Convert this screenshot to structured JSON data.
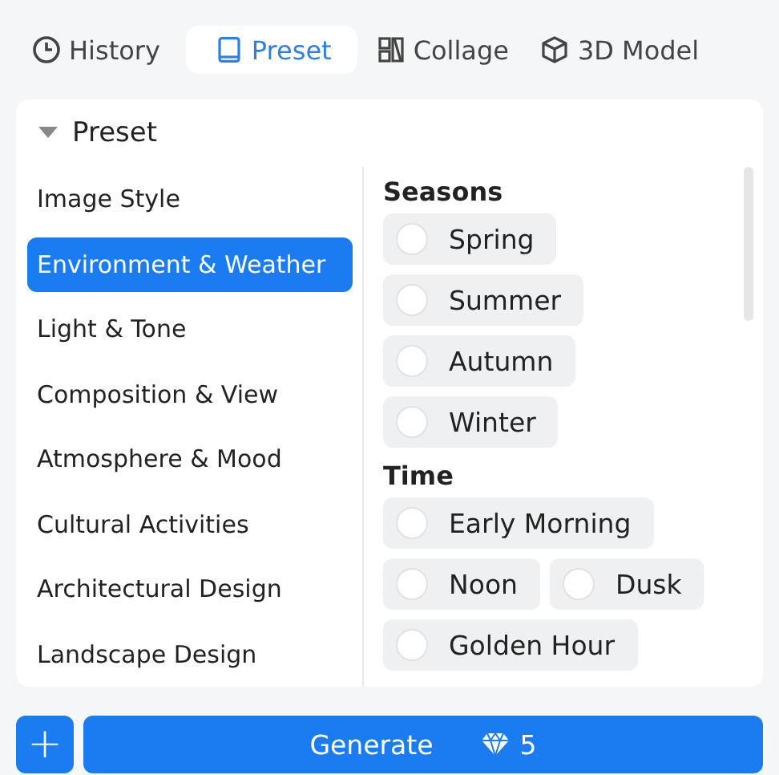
{
  "tabs": [
    {
      "label": "History",
      "selected": false
    },
    {
      "label": "Preset",
      "selected": true
    },
    {
      "label": "Collage",
      "selected": false
    },
    {
      "label": "3D Model",
      "selected": false
    }
  ],
  "panel": {
    "title": "Preset",
    "expanded": true,
    "categories": [
      {
        "label": "Image Style",
        "selected": false
      },
      {
        "label": "Environment & Weather",
        "selected": true
      },
      {
        "label": "Light & Tone",
        "selected": false
      },
      {
        "label": "Composition & View",
        "selected": false
      },
      {
        "label": "Atmosphere & Mood",
        "selected": false
      },
      {
        "label": "Cultural Activities",
        "selected": false
      },
      {
        "label": "Architectural Design",
        "selected": false
      },
      {
        "label": "Landscape Design",
        "selected": false
      }
    ],
    "groups": [
      {
        "heading": "Seasons",
        "options": [
          {
            "label": "Spring",
            "selected": false
          },
          {
            "label": "Summer",
            "selected": false
          },
          {
            "label": "Autumn",
            "selected": false
          },
          {
            "label": "Winter",
            "selected": false
          }
        ]
      },
      {
        "heading": "Time",
        "options": [
          {
            "label": "Early Morning",
            "selected": false
          },
          {
            "label": "Noon",
            "selected": false
          },
          {
            "label": "Dusk",
            "selected": false
          },
          {
            "label": "Golden Hour",
            "selected": false
          }
        ]
      }
    ]
  },
  "footer": {
    "add": "+",
    "generate": "Generate",
    "cost": "5"
  }
}
